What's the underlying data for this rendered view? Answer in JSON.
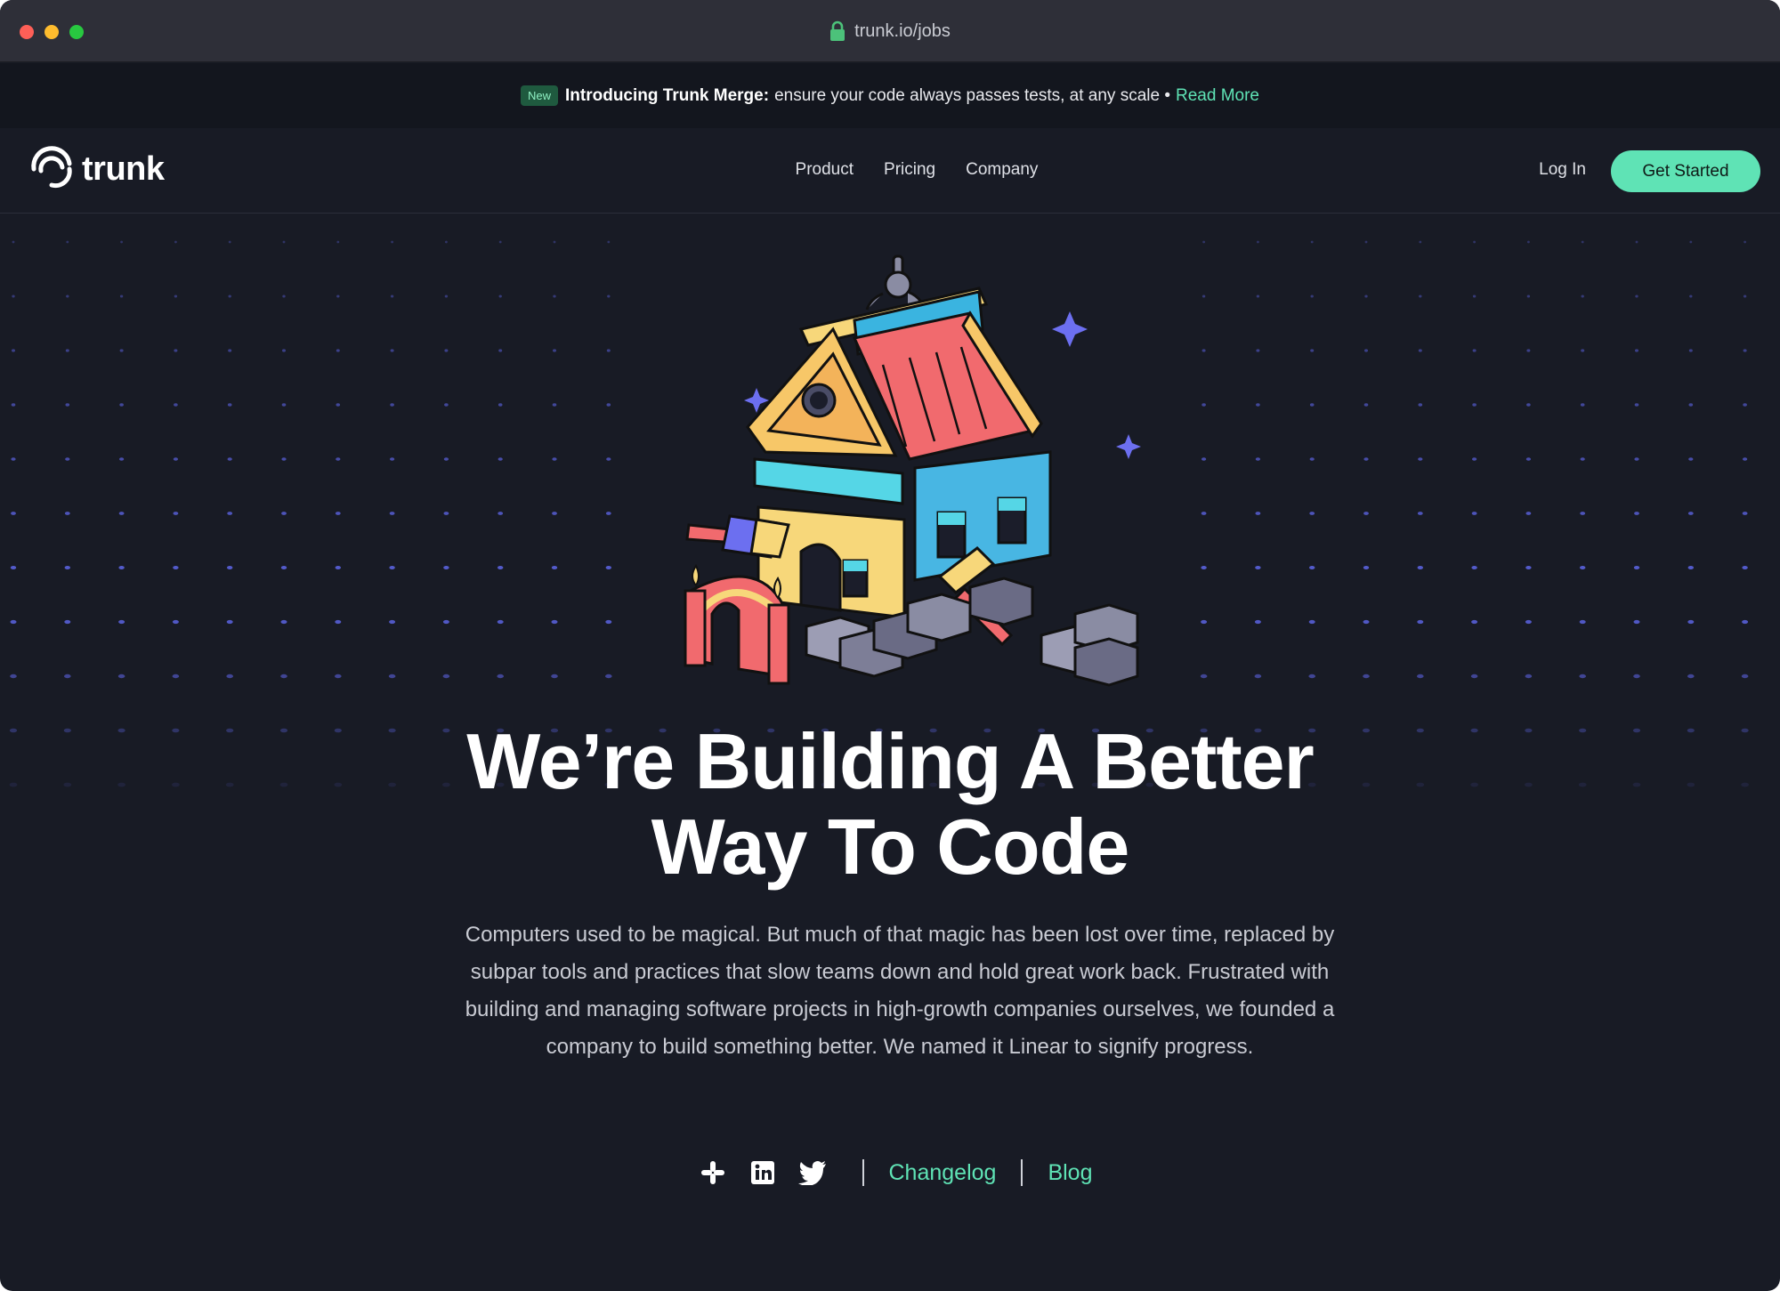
{
  "browser": {
    "url": "trunk.io/jobs",
    "lights": [
      "close",
      "minimize",
      "maximize"
    ]
  },
  "announcement": {
    "badge": "New",
    "bold": "Introducing Trunk Merge:",
    "text": "ensure your code always passes tests, at any scale •",
    "link": "Read More"
  },
  "nav": {
    "logo_text": "trunk",
    "links": [
      "Product",
      "Pricing",
      "Company"
    ],
    "login": "Log In",
    "cta": "Get Started"
  },
  "hero": {
    "headline_line1": "We’re Building A Better",
    "headline_line2": "Way To Code",
    "paragraph": "Computers used to be magical. But much of that magic has been lost over time, replaced by subpar tools and practices that slow teams down and hold great work back. Frustrated with building and managing software projects in high-growth companies ourselves, we founded a company to build something better. We named it Linear to signify progress."
  },
  "footer_links": {
    "icons": [
      "slack-icon",
      "linkedin-icon",
      "twitter-icon"
    ],
    "changelog": "Changelog",
    "blog": "Blog"
  },
  "colors": {
    "background": "#181b25",
    "accent": "#5fe3b5",
    "dot": "#5b63e0"
  }
}
